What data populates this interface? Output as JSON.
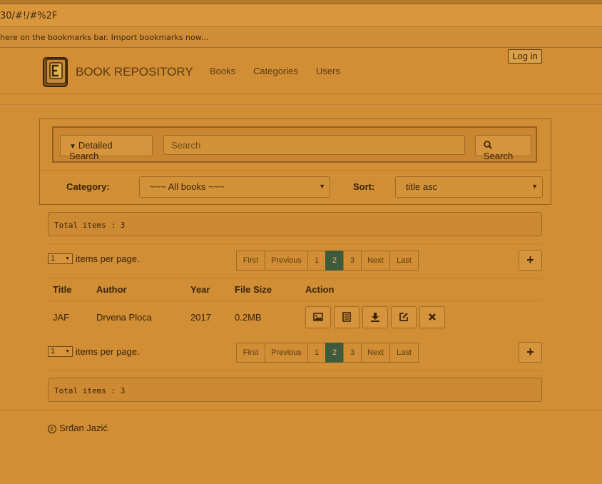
{
  "browser": {
    "address": "30/#!/#%2F",
    "bookmarks_text": "here on the bookmarks bar. Import bookmarks now..."
  },
  "navbar": {
    "brand": "BOOK REPOSITORY",
    "links": [
      "Books",
      "Categories",
      "Users"
    ],
    "login": "Log in"
  },
  "search": {
    "detailed_label": "Detailed Search",
    "placeholder": "Search",
    "button": "Search"
  },
  "filters": {
    "category_label": "Category:",
    "category_value": "~~~ All books ~~~",
    "sort_label": "Sort:",
    "sort_value": "title asc"
  },
  "total_text": "Total items : 3",
  "pagination": {
    "per_page_value": "1",
    "per_page_label": "items per page.",
    "pages": [
      "First",
      "Previous",
      "1",
      "2",
      "3",
      "Next",
      "Last"
    ],
    "active_page": "2"
  },
  "table": {
    "headers": [
      "Title",
      "Author",
      "Year",
      "File Size",
      "Action"
    ],
    "rows": [
      {
        "title": "JAF",
        "author": "Drvena Ploca",
        "year": "2017",
        "size": "0.2MB"
      }
    ],
    "actions": [
      "image-icon",
      "list-icon",
      "download-icon",
      "edit-icon",
      "delete-icon"
    ]
  },
  "footer": {
    "copyright": "Srđan Jazić"
  },
  "colors": {
    "background": "#d18e35",
    "active_page": "#3f5b3d"
  }
}
